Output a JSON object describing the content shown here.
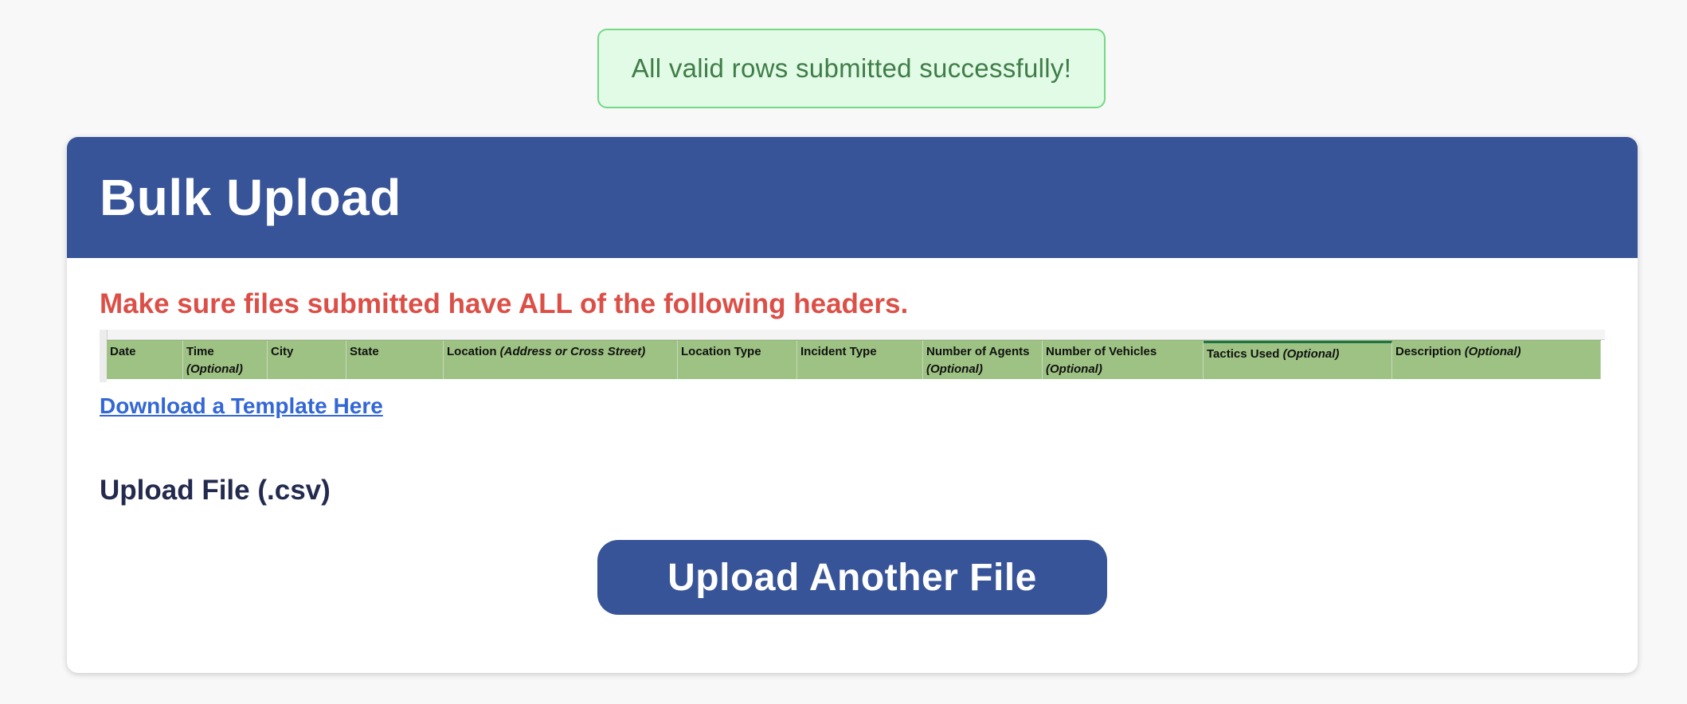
{
  "toast": {
    "message": "All valid rows submitted successfully!",
    "colors": {
      "background": "#e2fbe6",
      "border": "#74d884",
      "text": "#3f7d47"
    }
  },
  "card": {
    "title": "Bulk Upload",
    "header_color": "#385498",
    "warning": "Make sure files submitted have ALL of the following headers.",
    "warning_color": "#dc4f47",
    "sheet": {
      "header_fill_color": "#9dc283",
      "columns": [
        {
          "label": "Date",
          "optional": ""
        },
        {
          "label": "Time",
          "optional": "(Optional)"
        },
        {
          "label": "City",
          "optional": ""
        },
        {
          "label": "State",
          "optional": ""
        },
        {
          "label": "Location",
          "optional": "(Address or Cross Street)"
        },
        {
          "label": "Location Type",
          "optional": ""
        },
        {
          "label": "Incident Type",
          "optional": ""
        },
        {
          "label": "Number of Agents",
          "optional": "(Optional)"
        },
        {
          "label": "Number of Vehicles",
          "optional": "(Optional)"
        },
        {
          "label": "Tactics Used",
          "optional": "(Optional)"
        },
        {
          "label": "Description",
          "optional": "(Optional)"
        }
      ]
    },
    "template_link": "Download a Template Here",
    "upload_label": "Upload File (.csv)",
    "upload_button": "Upload Another File"
  }
}
